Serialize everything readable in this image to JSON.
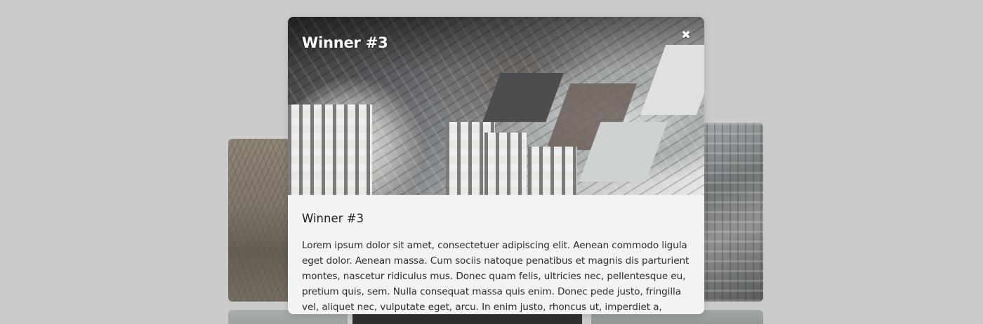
{
  "modal": {
    "header_title": "Winner #3",
    "close_icon": "close-icon",
    "close_glyph": "✖",
    "body_title": "Winner #3",
    "body_text": "Lorem ipsum dolor sit amet, consectetuer adipiscing elit. Aenean commodo ligula eget dolor. Aenean massa. Cum sociis natoque penatibus et magnis dis parturient montes, nascetur ridiculus mus. Donec quam felis, ultricies nec, pellentesque eu, pretium quis, sem. Nulla consequat massa quis enim. Donec pede justo, fringilla vel, aliquet nec, vulputate eget, arcu. In enim justo, rhoncus ut, imperdiet a,"
  },
  "colors": {
    "backdrop": "#cbcbcb",
    "modal_background": "#f2f3f5",
    "header_text": "#ffffff",
    "body_text": "#2b2b2b"
  }
}
